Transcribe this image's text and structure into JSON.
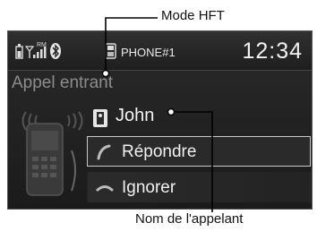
{
  "callouts": {
    "mode": "Mode HFT",
    "caller": "Nom de l'appelant"
  },
  "status": {
    "phone_name": "PHONE#1",
    "clock": "12:34",
    "roaming_indicator": "RM"
  },
  "incoming_label": "Appel entrant",
  "caller": {
    "name": "John"
  },
  "actions": {
    "answer": "Répondre",
    "ignore": "Ignorer"
  },
  "icons": [
    "battery-icon",
    "signal-icon",
    "bluetooth-icon",
    "phone-icon",
    "contact-icon",
    "answer-icon",
    "hangup-icon"
  ],
  "colors": {
    "screen_bg": "#222222",
    "text": "#f2f2f2",
    "dim_text": "#8c8c8c",
    "selection_border": "#c9c9c9"
  }
}
